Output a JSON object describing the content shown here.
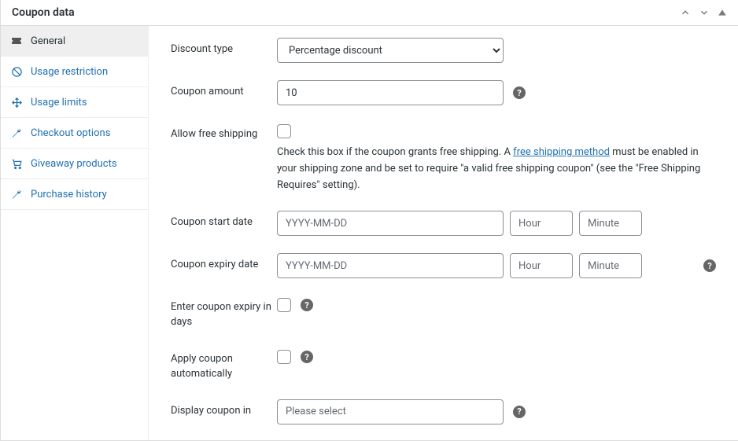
{
  "panel": {
    "title": "Coupon data"
  },
  "sidebar": {
    "items": [
      {
        "label": "General"
      },
      {
        "label": "Usage restriction"
      },
      {
        "label": "Usage limits"
      },
      {
        "label": "Checkout options"
      },
      {
        "label": "Giveaway products"
      },
      {
        "label": "Purchase history"
      }
    ]
  },
  "form": {
    "discount_type": {
      "label": "Discount type",
      "selected": "Percentage discount"
    },
    "coupon_amount": {
      "label": "Coupon amount",
      "value": "10"
    },
    "free_shipping": {
      "label": "Allow free shipping",
      "text_before": "Check this box if the coupon grants free shipping. A ",
      "link_text": "free shipping method",
      "text_after": " must be enabled in your shipping zone and be set to require \"a valid free shipping coupon\" (see the \"Free Shipping Requires\" setting)."
    },
    "start_date": {
      "label": "Coupon start date",
      "date_ph": "YYYY-MM-DD",
      "hour_ph": "Hour",
      "minute_ph": "Minute"
    },
    "expiry_date": {
      "label": "Coupon expiry date",
      "date_ph": "YYYY-MM-DD",
      "hour_ph": "Hour",
      "minute_ph": "Minute"
    },
    "expiry_days": {
      "label": "Enter coupon expiry in days"
    },
    "auto_apply": {
      "label": "Apply coupon automatically"
    },
    "display_in": {
      "label": "Display coupon in",
      "placeholder": "Please select"
    }
  }
}
